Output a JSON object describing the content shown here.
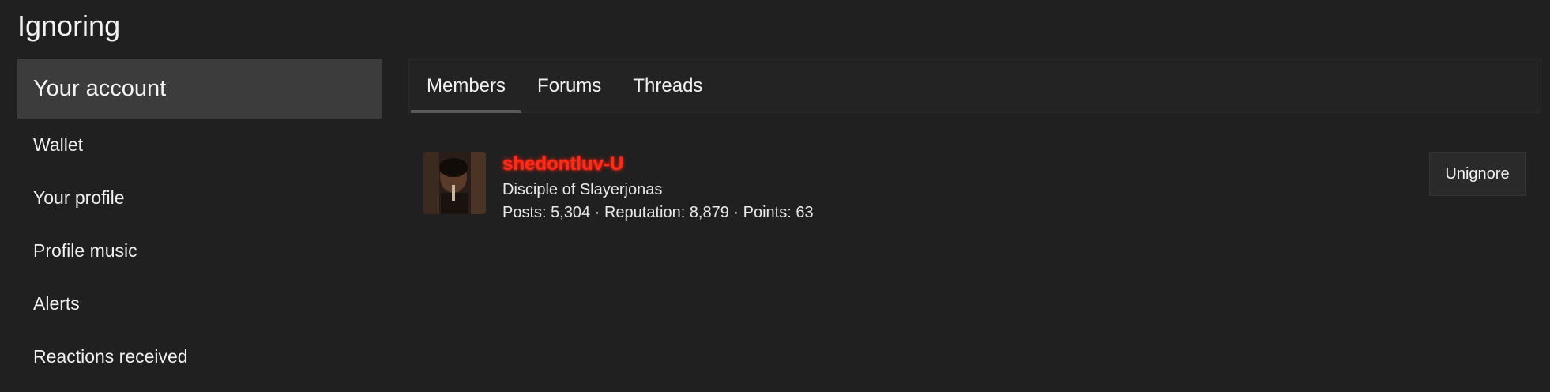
{
  "page": {
    "title": "Ignoring"
  },
  "sidebar": {
    "header": "Your account",
    "items": [
      {
        "label": "Wallet"
      },
      {
        "label": "Your profile"
      },
      {
        "label": "Profile music"
      },
      {
        "label": "Alerts"
      },
      {
        "label": "Reactions received"
      }
    ]
  },
  "tabs": [
    {
      "label": "Members",
      "active": true
    },
    {
      "label": "Forums",
      "active": false
    },
    {
      "label": "Threads",
      "active": false
    }
  ],
  "member": {
    "username": "shedontluv-U",
    "username_color": "#ff2a1a",
    "user_title": "Disciple of Slayerjonas",
    "stats": "Posts: 5,304 · Reputation: 8,879 · Points: 63",
    "avatar_icon": "user-avatar",
    "action_label": "Unignore"
  },
  "colors": {
    "background": "#202020",
    "sidebar_active": "#3c3c3c",
    "tab_underline": "#5a5a5a"
  }
}
